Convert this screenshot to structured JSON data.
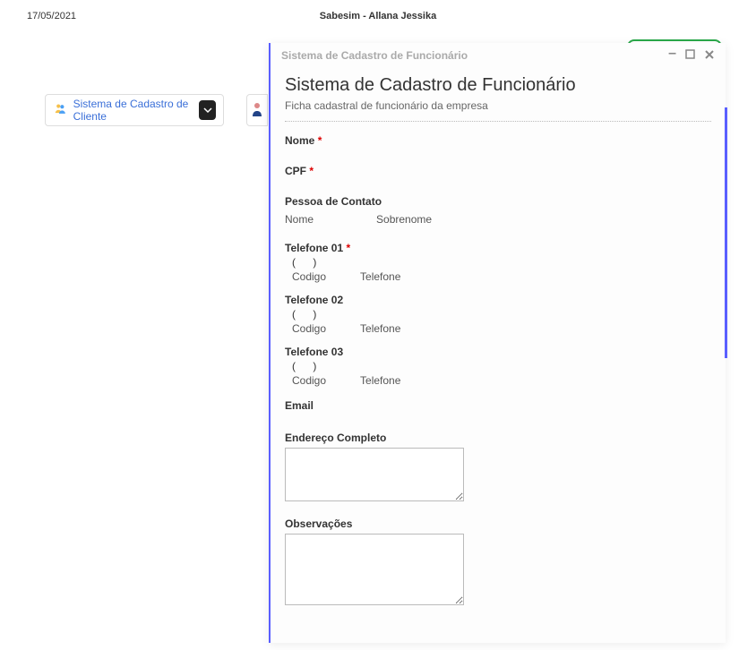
{
  "header": {
    "date": "17/05/2021",
    "title": "Sabesim - Allana Jessika"
  },
  "background": {
    "client_card_label": "Sistema de Cadastro de Cliente"
  },
  "modal": {
    "titlebar": "Sistema de Cadastro de Funcionário",
    "heading": "Sistema de Cadastro de Funcionário",
    "subtitle": "Ficha cadastral de funcionário da empresa",
    "fields": {
      "nome_label": "Nome",
      "cpf_label": "CPF",
      "pessoa_contato_label": "Pessoa de Contato",
      "contato_nome_sub": "Nome",
      "contato_sobrenome_sub": "Sobrenome",
      "tel1_label": "Telefone 01",
      "tel2_label": "Telefone 02",
      "tel3_label": "Telefone 03",
      "paren": "(       )",
      "codigo_sub": "Codigo",
      "telefone_sub": "Telefone",
      "email_label": "Email",
      "endereco_label": "Endereço Completo",
      "obs_label": "Observações",
      "asterisk": "*"
    }
  }
}
